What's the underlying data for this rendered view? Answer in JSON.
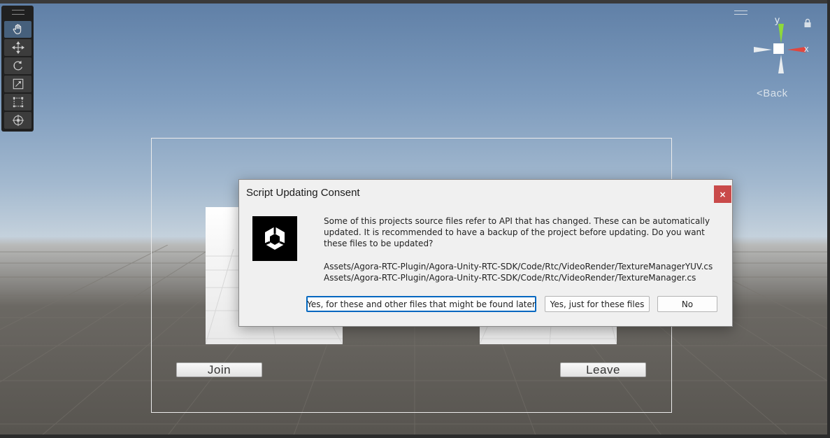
{
  "scene": {
    "gizmo": {
      "y_axis": "y",
      "x_axis": "x",
      "back_label": "<Back"
    }
  },
  "game_view": {
    "join_label": "Join",
    "leave_label": "Leave"
  },
  "tools": [
    {
      "name": "hand-tool",
      "icon": "hand-icon",
      "active": true
    },
    {
      "name": "move-tool",
      "icon": "move-icon",
      "active": false
    },
    {
      "name": "rotate-tool",
      "icon": "rotate-icon",
      "active": false
    },
    {
      "name": "scale-tool",
      "icon": "scale-icon",
      "active": false
    },
    {
      "name": "rect-tool",
      "icon": "rect-icon",
      "active": false
    },
    {
      "name": "transform-tool",
      "icon": "transform-icon",
      "active": false
    }
  ],
  "dialog": {
    "title": "Script Updating Consent",
    "close_glyph": "×",
    "message": "Some of this projects source files refer to API that has changed. These can be automatically updated. It is recommended to have a backup of the project before updating. Do you want these files to be updated?",
    "files": [
      "Assets/Agora-RTC-Plugin/Agora-Unity-RTC-SDK/Code/Rtc/VideoRender/TextureManagerYUV.cs",
      "Assets/Agora-RTC-Plugin/Agora-Unity-RTC-SDK/Code/Rtc/VideoRender/TextureManager.cs"
    ],
    "buttons": {
      "yes_all": "Yes, for these and other files that might be found later",
      "yes_these": "Yes, just for these files",
      "no": "No"
    }
  },
  "colors": {
    "accent": "#0067c0",
    "close_button": "#c94a4a",
    "gizmo_y": "#8ed93a",
    "gizmo_x": "#e0473f",
    "active_tool": "#46607c"
  }
}
